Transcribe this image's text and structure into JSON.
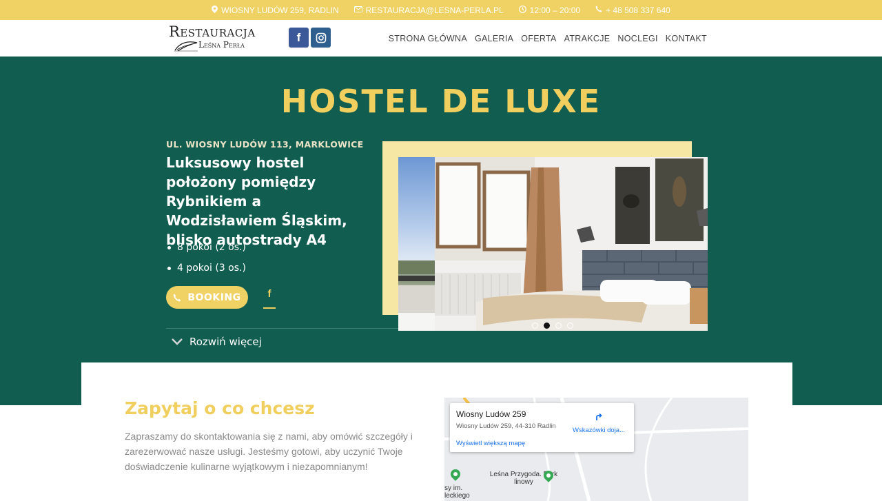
{
  "topbar": {
    "address": "WIOSNY LUDÓW 259, RADLIN",
    "email": "RESTAURACJA@LESNA-PERLA.PL",
    "hours": "12:00 – 20:00",
    "phone": "+ 48 508 337 640"
  },
  "logo": {
    "line1": "Restauracja",
    "line2": "Leśna Perła"
  },
  "nav": {
    "items": [
      "STRONA GŁÓWNA",
      "GALERIA",
      "OFERTA",
      "ATRAKCJE",
      "NOCLEGI",
      "KONTAKT"
    ]
  },
  "hero": {
    "title": "HOSTEL DE LUXE",
    "address": "UL. WIOSNY LUDÓW 113, MARKLOWICE",
    "lead": "Luksusowy hostel położony pomiędzy Rybnikiem a Wodzisławiem Śląskim, blisko autostrady A4",
    "bullets": [
      "8 pokoi (2 os.)",
      "4 pokoi (3 os.)"
    ],
    "booking_label": "BOOKING",
    "expand_label": "Rozwiń więcej",
    "slider": {
      "slide_count": 4,
      "active_index": 1
    }
  },
  "contact": {
    "title": "Zapytaj o co chcesz",
    "text": "Zapraszamy do skontaktowania się z nami, aby omówić szczegóły i zarezerwować nasze usługi. Jesteśmy gotowi, aby uczynić Twoje doświadczenie kulinarne wyjątkowym i niezapomnianym!"
  },
  "map": {
    "place_name": "Wiosny Ludów 259",
    "place_address": "Wiosny Ludów 259, 44-310 Radlin",
    "larger_map_link": "Wyświetl większą mapę",
    "directions_label": "Wskazówki doja...",
    "poi_1": "Leśna Przygoda. Park linowy",
    "poi_2": "Ośrodek Sportowy im. Józefa Nieboleckiego",
    "poi_2_visible": "sy im. leckiego"
  },
  "colors": {
    "accent_yellow": "#f0d264",
    "hero_green": "#115e51",
    "facebook_blue": "#3b5998"
  }
}
